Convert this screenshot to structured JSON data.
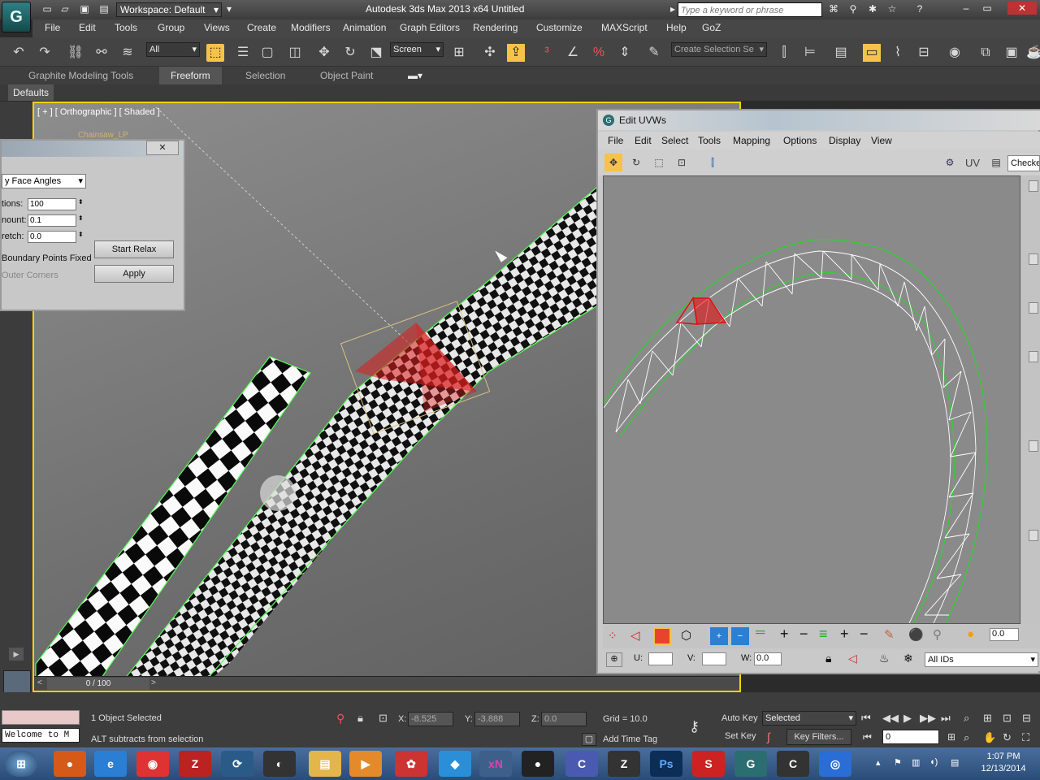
{
  "title_bar": {
    "logo": "G",
    "workspace": "Workspace: Default",
    "app_title": "Autodesk 3ds Max  2013 x64      Untitled",
    "search_placeholder": "Type a keyword or phrase"
  },
  "menu": [
    "File",
    "Edit",
    "Tools",
    "Group",
    "Views",
    "Create",
    "Modifiers",
    "Animation",
    "Graph Editors",
    "Rendering",
    "Customize",
    "MAXScript",
    "Help",
    "GoZ"
  ],
  "toolbar": {
    "selection_filter": "All",
    "ref_coord": "Screen",
    "named_selection": "Create Selection Se"
  },
  "ribbon": {
    "tabs": [
      "Graphite Modeling Tools",
      "Freeform",
      "Selection",
      "Object Paint"
    ],
    "active": "Freeform",
    "defaults_label": "Defaults"
  },
  "viewport": {
    "label": "[ + ] [ Orthographic ] [ Shaded ]",
    "object_name": "Chainsaw_LP"
  },
  "relax_dialog": {
    "method": "y Face Angles",
    "iterations_label": "tions:",
    "iterations": "100",
    "amount_label": "nount:",
    "amount": "0.1",
    "stretch_label": "retch:",
    "stretch": "0.0",
    "keep_boundary": "Boundary Points Fixed",
    "outer_corners": "Outer Corners",
    "start_relax": "Start Relax",
    "apply": "Apply"
  },
  "uv_editor": {
    "title": "Edit UVWs",
    "menu": [
      "File",
      "Edit",
      "Select",
      "Tools",
      "Mapping",
      "Options",
      "Display",
      "View"
    ],
    "uv_label": "UV",
    "checker": "Checker",
    "u_label": "U:",
    "v_label": "V:",
    "w_label": "W:",
    "w_value": "0.0",
    "spin_value": "0.0",
    "ids": "All IDs"
  },
  "status": {
    "welcome": "Welcome to M",
    "selected": "1 Object Selected",
    "prompt": "ALT subtracts from selection",
    "x_label": "X:",
    "x": "-8.525",
    "y_label": "Y:",
    "y": "-3.888",
    "z_label": "Z:",
    "z": "0.0",
    "grid": "Grid = 10.0",
    "add_time_tag": "Add Time Tag",
    "auto_key": "Auto Key",
    "set_key": "Set Key",
    "key_filter": "Selected",
    "key_filters_btn": "Key Filters...",
    "frame": "0",
    "timeline": "0 / 100"
  },
  "taskbar": {
    "time": "1:07 PM",
    "date": "12/13/2014",
    "apps": [
      "firefox-icon",
      "ie-icon",
      "chrome-icon",
      "filezilla-icon",
      "app5-icon",
      "app6-icon",
      "folder-icon",
      "media-icon",
      "app9-icon",
      "dropbox-icon",
      "xnview-icon",
      "app12-icon",
      "app13-icon",
      "zbrush-icon",
      "photoshop-icon",
      "app16-icon",
      "3dsmax-icon",
      "app18-icon",
      "app19-icon"
    ]
  }
}
